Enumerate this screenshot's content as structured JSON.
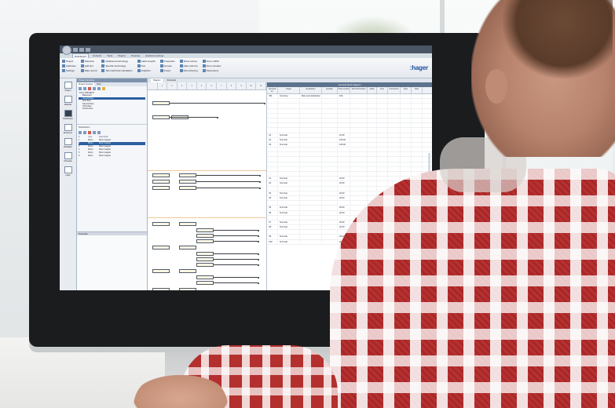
{
  "app": {
    "title": "",
    "tabs": [
      "Distribution",
      "Controls",
      "Tools",
      "Plugins",
      "Drawing",
      "Assistant settings"
    ],
    "active_tab": "Distribution",
    "brand": ":hager"
  },
  "ribbon": {
    "groups": [
      [
        "Project",
        "Attributes",
        "Settings"
      ],
      [
        "Selection",
        "Add text",
        "Data record"
      ],
      [
        "Additional technology",
        "Specific technology",
        "Terminal block calculation"
      ],
      [
        "Cable lengths",
        "Text",
        "Graphics"
      ],
      [
        "Properties",
        "Groups",
        "Fuses"
      ],
      [
        "Show entries",
        "Hide columns",
        "Renumbering"
      ],
      [
        "Zoom 100%",
        "Zoom window",
        "Parameters"
      ]
    ]
  },
  "leftnav": {
    "items": [
      {
        "label": "Project",
        "icon": "folder-icon"
      },
      {
        "label": "Material",
        "icon": "box-icon"
      },
      {
        "label": "Distribution",
        "icon": "panel-icon"
      },
      {
        "label": "Enclosure",
        "icon": "cabinet-icon"
      },
      {
        "label": "Bookable",
        "icon": "document-icon"
      },
      {
        "label": "Schedule",
        "icon": "list-icon"
      },
      {
        "label": "Label",
        "icon": "tag-icon"
      }
    ],
    "active": "Distribution"
  },
  "panel": {
    "header": "Project structure",
    "tabs": [
      "Project structure",
      "Floor"
    ],
    "tree": [
      {
        "label": "FULL PROJECT",
        "selected": false
      },
      {
        "label": "Basement",
        "selected": false
      },
      {
        "label": "Ground floor",
        "selected": true
      },
      {
        "label": "First floor",
        "selected": false
      },
      {
        "label": "Second floor",
        "selected": false
      },
      {
        "label": "Third floor",
        "selected": false
      },
      {
        "label": "Fourth floor",
        "selected": false
      }
    ],
    "list_title": "Distributions",
    "list_header": [
      "#",
      "Type",
      "Description"
    ],
    "list_rows": [
      {
        "id": "1",
        "type": "Room",
        "desc": "Room magnet",
        "selected": false
      },
      {
        "id": "2",
        "type": "Room",
        "desc": "Room magnet",
        "selected": true
      },
      {
        "id": "3",
        "type": "Room",
        "desc": "Room magnet",
        "selected": false
      },
      {
        "id": "4",
        "type": "Room",
        "desc": "Room magnet",
        "selected": false
      },
      {
        "id": "5",
        "type": "Room",
        "desc": "Room magnet",
        "selected": false
      },
      {
        "id": "6",
        "type": "Room",
        "desc": "Room magnet",
        "selected": false
      }
    ],
    "properties": "Properties"
  },
  "document": {
    "tabs": [
      "Diagram",
      "Schematic"
    ],
    "grid_title": "Terminal block diagram",
    "columns": [
      "Terminal no.",
      "Target",
      "Destination",
      "Location",
      "Cross-section",
      "Terminal function",
      "Cable",
      "Core",
      "Connection",
      "Type",
      "Note"
    ],
    "rows": [
      [
        "X01",
        "Incoming",
        "Main sub-distribution",
        "",
        "16A",
        "",
        "",
        "",
        "",
        "",
        ""
      ],
      [
        "",
        "",
        "",
        "",
        "",
        "",
        "",
        "",
        "",
        "",
        ""
      ],
      [
        "",
        "",
        "",
        "",
        "",
        "",
        "",
        "",
        "",
        "",
        ""
      ],
      [
        "",
        "",
        "",
        "",
        "",
        "",
        "",
        "",
        "",
        "",
        ""
      ],
      [
        "",
        "",
        "",
        "",
        "",
        "",
        "",
        "",
        "",
        "",
        ""
      ],
      [
        "",
        "",
        "",
        "",
        "",
        "",
        "",
        "",
        "",
        "",
        ""
      ],
      [
        "",
        "",
        "",
        "",
        "",
        "",
        "",
        "",
        "",
        "",
        ""
      ],
      [
        "",
        "",
        "",
        "",
        "",
        "",
        "",
        "",
        "",
        "",
        ""
      ],
      [
        "X1",
        "Terminal",
        "",
        "",
        "10.00",
        "",
        "",
        "",
        "",
        "",
        ""
      ],
      [
        "X2",
        "Terminal",
        "",
        "",
        "100.00",
        "",
        "",
        "",
        "",
        "",
        ""
      ],
      [
        "X3",
        "Terminal",
        "",
        "",
        "100.00",
        "",
        "",
        "",
        "",
        "",
        ""
      ],
      [
        "",
        "",
        "",
        "",
        "",
        "",
        "",
        "",
        "",
        "",
        ""
      ],
      [
        "",
        "",
        "",
        "",
        "",
        "",
        "",
        "",
        "",
        "",
        ""
      ],
      [
        "",
        "",
        "",
        "",
        "",
        "",
        "",
        "",
        "",
        "",
        ""
      ],
      [
        "",
        "",
        "",
        "",
        "",
        "",
        "",
        "",
        "",
        "",
        ""
      ],
      [
        "",
        "",
        "",
        "",
        "",
        "",
        "",
        "",
        "",
        "",
        ""
      ],
      [
        "",
        "",
        "",
        "",
        "",
        "",
        "",
        "",
        "",
        "",
        ""
      ],
      [
        "X1",
        "Terminal",
        "",
        "",
        "20.00",
        "",
        "",
        "",
        "",
        "",
        ""
      ],
      [
        "X2",
        "Terminal",
        "",
        "",
        "20.00",
        "",
        "",
        "",
        "",
        "",
        ""
      ],
      [
        "",
        "",
        "",
        "",
        "",
        "",
        "",
        "",
        "",
        "",
        ""
      ],
      [
        "X3",
        "Terminal",
        "",
        "",
        "20.00",
        "",
        "",
        "",
        "",
        "",
        ""
      ],
      [
        "X4",
        "Terminal",
        "",
        "",
        "20.00",
        "",
        "",
        "",
        "",
        "",
        ""
      ],
      [
        "",
        "",
        "",
        "",
        "",
        "",
        "",
        "",
        "",
        "",
        ""
      ],
      [
        "X5",
        "Terminal",
        "",
        "",
        "20.00",
        "",
        "",
        "",
        "",
        "",
        ""
      ],
      [
        "X6",
        "Terminal",
        "",
        "",
        "20.00",
        "",
        "",
        "",
        "",
        "",
        ""
      ],
      [
        "",
        "",
        "",
        "",
        "",
        "",
        "",
        "",
        "",
        "",
        ""
      ],
      [
        "X7",
        "Terminal",
        "",
        "",
        "20.00",
        "",
        "",
        "",
        "",
        "",
        ""
      ],
      [
        "X8",
        "Terminal",
        "",
        "",
        "20.00",
        "",
        "",
        "",
        "",
        "",
        ""
      ],
      [
        "",
        "",
        "",
        "",
        "",
        "",
        "",
        "",
        "",
        "",
        ""
      ],
      [
        "X9",
        "Terminal",
        "",
        "",
        "20.00",
        "",
        "",
        "",
        "",
        "",
        ""
      ],
      [
        "X10",
        "Terminal",
        "",
        "",
        "20.00",
        "",
        "",
        "",
        "",
        "",
        ""
      ]
    ]
  },
  "schematic_columns": [
    "",
    "1",
    "2",
    "3",
    "4",
    "5",
    "6",
    "7",
    "8",
    "9",
    "10",
    "11"
  ]
}
